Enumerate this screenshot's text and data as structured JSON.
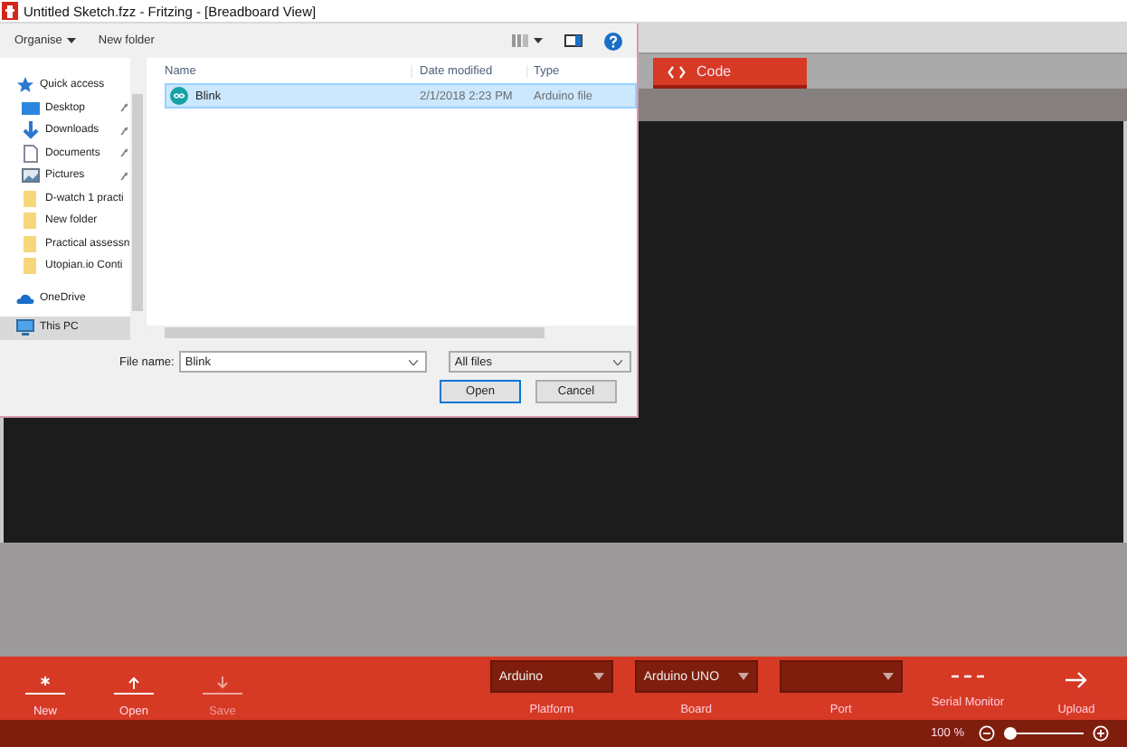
{
  "window": {
    "title": "Untitled Sketch.fzz - Fritzing - [Breadboard View]"
  },
  "tabs": [
    {
      "label": "Code",
      "selected": true
    }
  ],
  "dialog": {
    "toolbar": {
      "organise": "Organise",
      "new_folder": "New folder"
    },
    "nav": [
      {
        "label": "Quick access",
        "kind": "star",
        "pinned": false,
        "selected": false,
        "children": [
          {
            "label": "Desktop",
            "kind": "desktop",
            "pinned": true,
            "selected": false
          },
          {
            "label": "Downloads",
            "kind": "download",
            "pinned": true,
            "selected": false
          },
          {
            "label": "Documents",
            "kind": "document",
            "pinned": true,
            "selected": false
          },
          {
            "label": "Pictures",
            "kind": "picture",
            "pinned": true,
            "selected": false
          },
          {
            "label": "D-watch 1 practi",
            "kind": "folder",
            "pinned": false,
            "selected": false
          },
          {
            "label": "New folder",
            "kind": "folder",
            "pinned": false,
            "selected": false
          },
          {
            "label": "Practical assessn",
            "kind": "folder",
            "pinned": false,
            "selected": false
          },
          {
            "label": "Utopian.io Conti",
            "kind": "folder",
            "pinned": false,
            "selected": false
          }
        ]
      },
      {
        "label": "OneDrive",
        "kind": "cloud",
        "pinned": false,
        "selected": false
      },
      {
        "label": "This PC",
        "kind": "pc",
        "pinned": false,
        "selected": true
      }
    ],
    "columns": [
      "Name",
      "Date modified",
      "Type"
    ],
    "files": [
      {
        "name": "Blink",
        "date": "2/1/2018 2:23 PM",
        "type": "Arduino file",
        "selected": true
      }
    ],
    "file_name_label": "File name:",
    "file_name": "Blink",
    "file_type": "All files",
    "buttons": [
      {
        "label": "Open",
        "default": true
      },
      {
        "label": "Cancel",
        "default": false
      }
    ]
  },
  "toolbar": {
    "actions": [
      {
        "label": "New",
        "kind": "new",
        "disabled": false
      },
      {
        "label": "Open",
        "kind": "open",
        "disabled": false
      },
      {
        "label": "Save",
        "kind": "save",
        "disabled": true
      }
    ],
    "selects": [
      {
        "label": "Platform",
        "value": "Arduino"
      },
      {
        "label": "Board",
        "value": "Arduino UNO"
      },
      {
        "label": "Port"
      }
    ],
    "serial_monitor": "Serial Monitor",
    "upload": "Upload"
  },
  "status_bar": {
    "zoom": "100 %",
    "zoom_slider": {
      "level": 0.04
    }
  }
}
